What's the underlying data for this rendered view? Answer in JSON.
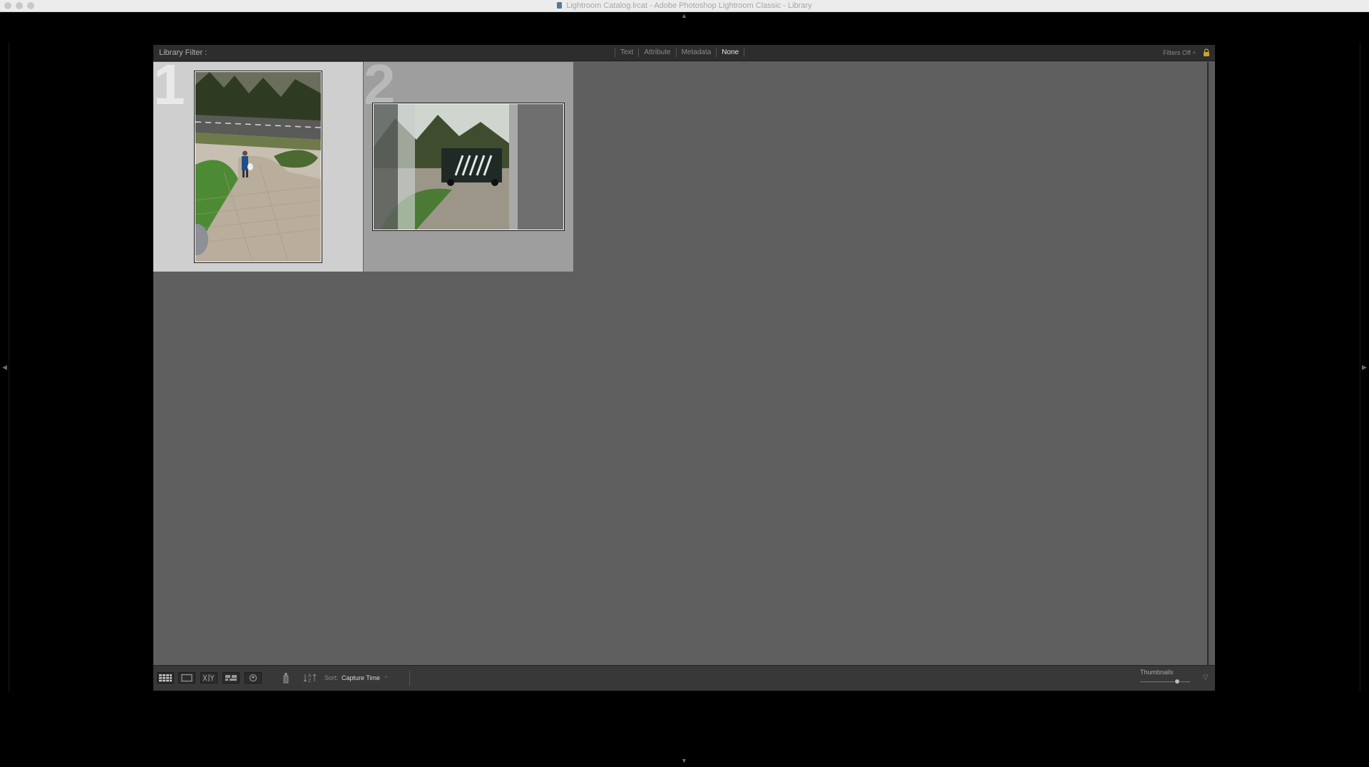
{
  "window": {
    "title": "Lightroom Catalog.lrcat - Adobe Photoshop Lightroom Classic - Library"
  },
  "filter_bar": {
    "label": "Library Filter :",
    "tabs": [
      {
        "label": "Text",
        "active": false
      },
      {
        "label": "Attribute",
        "active": false
      },
      {
        "label": "Metadata",
        "active": false
      },
      {
        "label": "None",
        "active": true
      }
    ],
    "preset": "Filters Off",
    "preset_caret": "÷"
  },
  "grid": {
    "cells": [
      {
        "index": "1",
        "selected": true,
        "orientation": "portrait"
      },
      {
        "index": "2",
        "selected": false,
        "orientation": "landscape"
      }
    ]
  },
  "toolbar": {
    "view_buttons": [
      "grid-view",
      "loupe-view",
      "compare-view",
      "survey-view",
      "people-view"
    ],
    "sort_label": "Sort:",
    "sort_value": "Capture Time",
    "sort_caret": "÷",
    "thumbnails_label": "Thumbnails",
    "thumbnail_size": 0.6,
    "menu_caret": "▽"
  },
  "colors": {
    "grid_background": "#5f5f5f",
    "selected_cell": "#cfcfcf",
    "unselected_cell": "#9e9e9e",
    "panel_background": "#2d2d2d"
  }
}
